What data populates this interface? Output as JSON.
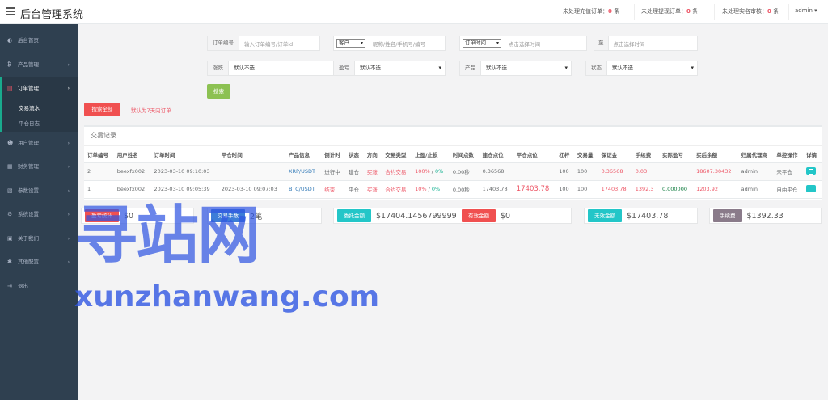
{
  "header": {
    "title": "后台管理系统",
    "notices": [
      {
        "label": "未处理充值订单：",
        "count": "0",
        "unit": "条"
      },
      {
        "label": "未处理提现订单：",
        "count": "0",
        "unit": "条"
      },
      {
        "label": "未处理实名审核：",
        "count": "0",
        "unit": "条"
      }
    ],
    "user": "admin ▾"
  },
  "sidebar": {
    "items": [
      {
        "label": "后台首页",
        "icon": "dashboard-icon",
        "arrow": ""
      },
      {
        "label": "产品管理",
        "icon": "bitcoin-icon",
        "arrow": "›"
      },
      {
        "label": "订单管理",
        "icon": "order-icon",
        "arrow": "›"
      },
      {
        "label": "用户管理",
        "icon": "users-icon",
        "arrow": "›"
      },
      {
        "label": "财务管理",
        "icon": "finance-icon",
        "arrow": "›"
      },
      {
        "label": "参数设置",
        "icon": "settings-icon",
        "arrow": "›"
      },
      {
        "label": "系统设置",
        "icon": "gears-icon",
        "arrow": "›"
      },
      {
        "label": "关于我们",
        "icon": "about-icon",
        "arrow": "›"
      },
      {
        "label": "其他配置",
        "icon": "config-icon",
        "arrow": "›"
      },
      {
        "label": "退出",
        "icon": "logout-icon",
        "arrow": ""
      }
    ],
    "subitems": [
      "交易流水",
      "平仓日志"
    ]
  },
  "filters": {
    "order_no_label": "订单编号",
    "order_no_placeholder": "输入订单编号/订单id",
    "customer_select": "客户",
    "customer_placeholder": "昵称/姓名/手机号/编号",
    "time_select": "订单时间",
    "time_start_placeholder": "点击选择时间",
    "time_sep": "至",
    "time_end_placeholder": "点击选择时间",
    "rise_fall_label": "涨跌",
    "rise_fall_value": "默认不选",
    "profit_label": "盈亏",
    "profit_value": "默认不选",
    "product_label": "产品",
    "product_value": "默认不选",
    "status_label": "状态",
    "status_value": "默认不选",
    "search_button": "搜索",
    "search_all_button": "搜索全部",
    "default_hint": "默认为7天内订单"
  },
  "table": {
    "title": "交易记录",
    "columns": [
      "订单编号",
      "用户姓名",
      "订单时间",
      "平仓时间",
      "产品信息",
      "倒计时",
      "状态",
      "方向",
      "交易类型",
      "止盈/止损",
      "时间点数",
      "建仓点位",
      "平仓点位",
      "杠杆",
      "交易量",
      "保证金",
      "手续费",
      "实际盈亏",
      "买后余额",
      "归属代理商",
      "单控操作",
      "详情"
    ],
    "rows": [
      {
        "id": "2",
        "user": "beexfx002",
        "order_time": "2023-03-10 09:10:03",
        "close_time": "",
        "product": "XRP/USDT",
        "countdown": "进行中",
        "status": "建仓",
        "direction": "买涨",
        "trade_type": "合约交易",
        "tp": "100%",
        "tp_sep": " / ",
        "sl": "0%",
        "time_points": "0.00秒",
        "open_price": "0.36568",
        "close_price": "",
        "leverage": "100",
        "volume": "100",
        "margin": "0.36568",
        "fee": "0.03",
        "profit": "",
        "balance": "18607.30432",
        "agent": "admin",
        "control": "未平仓"
      },
      {
        "id": "1",
        "user": "beexfx002",
        "order_time": "2023-03-10 09:05:39",
        "close_time": "2023-03-10 09:07:03",
        "product": "BTC/USDT",
        "countdown": "结束",
        "status": "平仓",
        "direction": "买涨",
        "trade_type": "合约交易",
        "tp": "10%",
        "tp_sep": " / ",
        "sl": "0%",
        "time_points": "0.00秒",
        "open_price": "17403.78",
        "close_price": "17403.78",
        "leverage": "100",
        "volume": "100",
        "margin": "17403.78",
        "fee": "1392.3",
        "profit": "0.000000",
        "balance": "1203.92",
        "agent": "admin",
        "control": "自由平仓"
      }
    ]
  },
  "stats": [
    {
      "label": "盈亏统计",
      "value": "$0",
      "color": "#f05050"
    },
    {
      "label": "交易手数",
      "value": "2笔",
      "color": "#3d7dd8"
    },
    {
      "label": "委托金额",
      "value": "$17404.1456799999",
      "color": "#23c6c8"
    },
    {
      "label": "有效金额",
      "value": "$0",
      "color": "#f05050"
    },
    {
      "label": "无效金额",
      "value": "$17403.78",
      "color": "#23c6c8"
    },
    {
      "label": "手续费",
      "value": "$1392.33",
      "color": "#8a7b8a"
    }
  ],
  "watermark": {
    "line1": "寻站网",
    "line2": "xunzhanwang.com"
  }
}
